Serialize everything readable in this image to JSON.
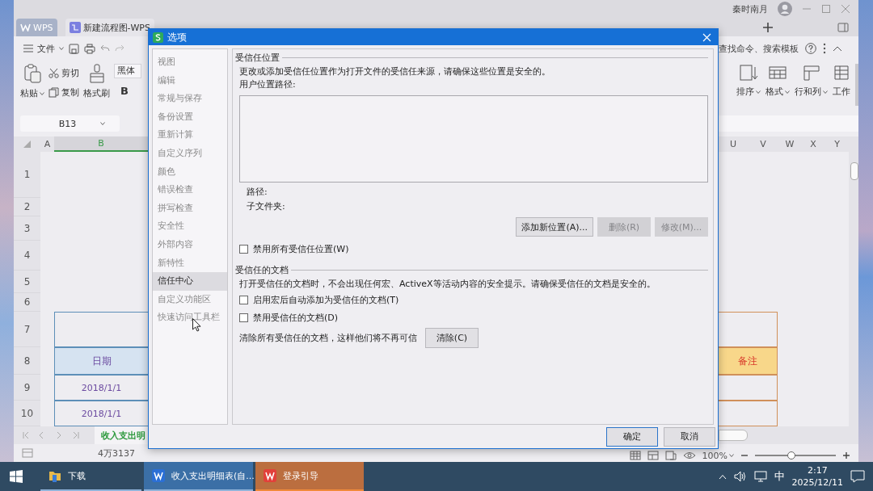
{
  "window": {
    "user_name": "秦时南月",
    "tabs": [
      {
        "label": "WPS",
        "kind": "home",
        "selected": false
      },
      {
        "label": "新建流程图-WPS",
        "kind": "flowchart",
        "selected": false
      }
    ]
  },
  "toolbar": {
    "file_menu": "文件",
    "search": {
      "placeholder": "查找命令、搜索模板"
    }
  },
  "ribbon": {
    "paste": "粘贴",
    "cut": "剪切",
    "copy": "复制",
    "format_painter": "格式刷",
    "font": "黑体",
    "bold": "B",
    "right_items": [
      {
        "label": "排序",
        "kind": "sort",
        "dropdown": true
      },
      {
        "label": "格式",
        "kind": "format",
        "dropdown": true
      },
      {
        "label": "行和列",
        "kind": "rows-cols",
        "dropdown": true
      },
      {
        "label": "工作",
        "kind": "sheet",
        "dropdown": false
      }
    ]
  },
  "sheet": {
    "name_box": "B13",
    "columns_left": [
      {
        "label": "A",
        "selected": false
      },
      {
        "label": "B",
        "selected": true
      }
    ],
    "columns_right": [
      {
        "label": "U",
        "selected": false
      },
      {
        "label": "V",
        "selected": false
      },
      {
        "label": "W",
        "selected": false
      },
      {
        "label": "X",
        "selected": false
      },
      {
        "label": "Y",
        "selected": false
      }
    ],
    "rows": [
      "1",
      "2",
      "3",
      "4",
      "5",
      "6",
      "7",
      "8",
      "9",
      "10"
    ],
    "table": [
      {
        "kind": "title"
      },
      {
        "kind": "header",
        "left": "日期",
        "right": "备注"
      },
      {
        "kind": "data",
        "left": "2018/1/1"
      },
      {
        "kind": "data",
        "left": "2018/1/1"
      }
    ],
    "sheet_tab": "收入支出明",
    "status": "4万3137",
    "zoom": {
      "label": "100%",
      "level": 0.45
    }
  },
  "dialog": {
    "title": "选项",
    "nav": [
      {
        "label": "视图",
        "selected": false
      },
      {
        "label": "编辑",
        "selected": false
      },
      {
        "label": "常规与保存",
        "selected": false
      },
      {
        "label": "备份设置",
        "selected": false
      },
      {
        "label": "重新计算",
        "selected": false
      },
      {
        "label": "自定义序列",
        "selected": false
      },
      {
        "label": "颜色",
        "selected": false
      },
      {
        "label": "错误检查",
        "selected": false
      },
      {
        "label": "拼写检查",
        "selected": false
      },
      {
        "label": "安全性",
        "selected": false
      },
      {
        "label": "外部内容",
        "selected": false
      },
      {
        "label": "新特性",
        "selected": false
      },
      {
        "label": "信任中心",
        "selected": true
      },
      {
        "label": "自定义功能区",
        "selected": false
      },
      {
        "label": "快速访问工具栏",
        "selected": false
      }
    ],
    "trusted_locations": {
      "heading": "受信任位置",
      "description": "更改或添加受信任位置作为打开文件的受信任来源，请确保这些位置是安全的。",
      "list_label": "用户位置路径:",
      "path_label": "路径:",
      "subfolder_label": "子文件夹:",
      "buttons": [
        {
          "label": "添加新位置(A)...",
          "disabled": false
        },
        {
          "label": "删除(R)",
          "disabled": true
        },
        {
          "label": "修改(M)...",
          "disabled": true
        }
      ],
      "disable_all": {
        "label": "禁用所有受信任位置(W)",
        "checked": false
      }
    },
    "trusted_documents": {
      "heading": "受信任的文档",
      "description": "打开受信任的文档时，不会出现任何宏、ActiveX等活动内容的安全提示。请确保受信任的文档是安全的。",
      "options": [
        {
          "label": "启用宏后自动添加为受信任的文档(T)",
          "checked": false
        },
        {
          "label": "禁用受信任的文档(D)",
          "checked": false
        }
      ],
      "clear_text": "清除所有受信任的文档，这样他们将不再可信",
      "clear_button": "清除(C)"
    },
    "buttons": [
      {
        "label": "确定",
        "default": true
      },
      {
        "label": "取消",
        "default": false
      }
    ]
  },
  "taskbar": {
    "items": [
      {
        "label": "下载",
        "kind": "folder",
        "selected": false,
        "attention": false
      },
      {
        "label": "收入支出明细表(自...",
        "kind": "wps",
        "selected": true,
        "attention": false
      },
      {
        "label": "登录引导",
        "kind": "wps-red",
        "selected": false,
        "attention": true
      }
    ],
    "ime": "中",
    "time": "2:17",
    "date": "2025/12/11"
  }
}
